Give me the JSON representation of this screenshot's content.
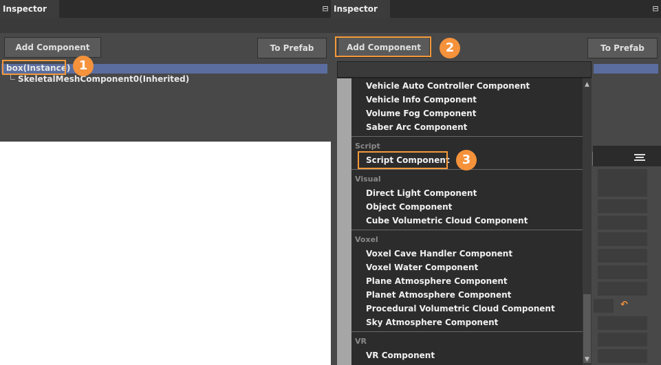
{
  "left_panel": {
    "tab_title": "Inspector",
    "add_component_label": "Add Component",
    "to_prefab_label": "To Prefab",
    "tree": {
      "selected_node": "box(Instance)",
      "child_node": "SkeletalMeshComponent0(Inherited)"
    }
  },
  "right_panel": {
    "tab_title": "Inspector",
    "add_component_label": "Add Component",
    "to_prefab_label": "To Prefab",
    "reset_icon": "undo-arrow-icon"
  },
  "dropdown": {
    "search_value": "",
    "groups": [
      {
        "category": "",
        "items": [
          "Vehicle Auto Controller Component",
          "Vehicle Info Component",
          "Volume Fog Component",
          "Saber Arc Component"
        ]
      },
      {
        "category": "Script",
        "items": [
          "Script Component"
        ]
      },
      {
        "category": "Visual",
        "items": [
          "Direct Light Component",
          "Object Component",
          "Cube Volumetric Cloud Component"
        ]
      },
      {
        "category": "Voxel",
        "items": [
          "Voxel Cave Handler Component",
          "Voxel Water Component",
          "Plane Atmosphere Component",
          "Planet Atmosphere Component",
          "Procedural Volumetric Cloud Component",
          "Sky Atmosphere Component"
        ]
      },
      {
        "category": "VR",
        "items": [
          "VR Component"
        ]
      }
    ]
  },
  "callouts": {
    "one": "1",
    "two": "2",
    "three": "3"
  },
  "colors": {
    "accent": "#f5923b",
    "selection": "#5a6d9e",
    "panel": "#484848"
  }
}
